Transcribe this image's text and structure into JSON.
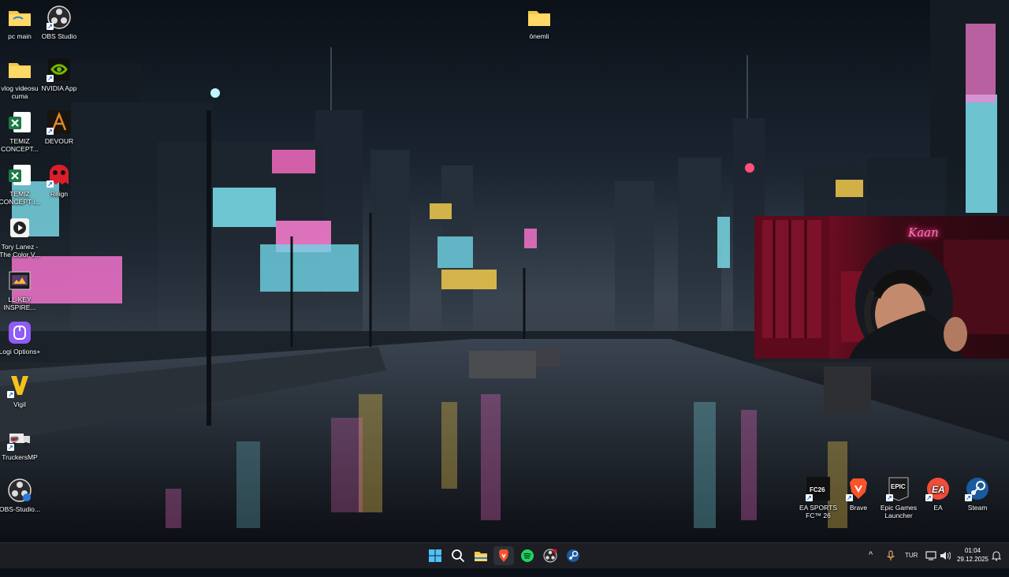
{
  "desktop": {
    "left_icons": [
      {
        "label": "pc main",
        "icon": "folder-icon"
      },
      {
        "label": "OBS Studio",
        "icon": "obs-icon"
      },
      {
        "label": "vlog videosu cuma",
        "icon": "folder-icon"
      },
      {
        "label": "NVIDIA App",
        "icon": "nvidia-icon"
      },
      {
        "label": "TEMIZ CONCEPT...",
        "icon": "excel-icon"
      },
      {
        "label": "DEVOUR",
        "icon": "devour-icon"
      },
      {
        "label": "TEMIZ CONCEPT i...",
        "icon": "excel-icon"
      },
      {
        "label": "Reign",
        "icon": "reign-icon"
      },
      {
        "label": "Tory Lanez - The Color V...",
        "icon": "video-icon"
      },
      {
        "label": "LL-KEY INSPIRE...",
        "icon": "video-file-icon"
      },
      {
        "label": "Logi Options+",
        "icon": "logi-icon"
      },
      {
        "label": "Vigil",
        "icon": "vigil-icon"
      },
      {
        "label": "TruckersMP",
        "icon": "truckersmp-icon"
      },
      {
        "label": "OBS-Studio...",
        "icon": "obs-installer-icon"
      }
    ],
    "top_icon": {
      "label": "önemli",
      "icon": "folder-icon"
    },
    "bottom_right_icons": [
      {
        "label": "EA SPORTS FC™ 26",
        "icon": "eafc-icon"
      },
      {
        "label": "Brave",
        "icon": "brave-icon"
      },
      {
        "label": "Epic Games Launcher",
        "icon": "epic-icon"
      },
      {
        "label": "EA",
        "icon": "ea-icon"
      },
      {
        "label": "Steam",
        "icon": "steam-icon"
      }
    ]
  },
  "webcam": {
    "sign_text": "Kaan"
  },
  "taskbar": {
    "pinned": [
      "start-icon",
      "search-icon",
      "file-explorer-icon",
      "brave-icon",
      "spotify-icon",
      "obs-icon",
      "steam-icon"
    ],
    "tray": {
      "overflow": "^",
      "language": "TUR",
      "time": "01:04",
      "date": "29.12.2025"
    }
  },
  "colors": {
    "taskbar": "#1c1e23",
    "accent": "#0078d4"
  }
}
